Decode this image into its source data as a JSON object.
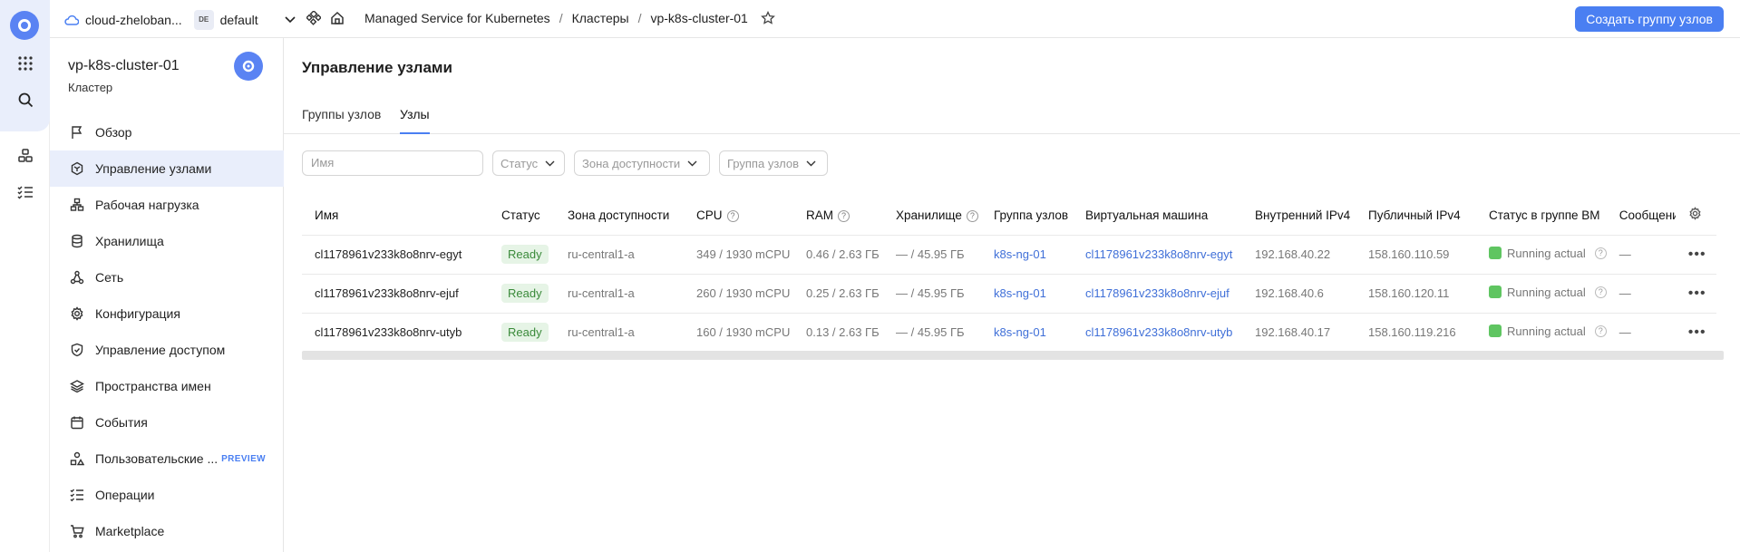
{
  "topbar": {
    "cloud_name": "cloud-zheloban...",
    "folder_badge": "DE",
    "folder_name": "default",
    "breadcrumbs": [
      "Managed Service for Kubernetes",
      "Кластеры",
      "vp-k8s-cluster-01"
    ],
    "create_button": "Создать группу узлов"
  },
  "sidebar": {
    "cluster_name": "vp-k8s-cluster-01",
    "cluster_type": "Кластер",
    "items": [
      {
        "label": "Обзор",
        "icon": "flag-icon"
      },
      {
        "label": "Управление узлами",
        "icon": "nodes-icon"
      },
      {
        "label": "Рабочая нагрузка",
        "icon": "workload-icon"
      },
      {
        "label": "Хранилища",
        "icon": "database-icon"
      },
      {
        "label": "Сеть",
        "icon": "network-icon"
      },
      {
        "label": "Конфигурация",
        "icon": "gear-icon"
      },
      {
        "label": "Управление доступом",
        "icon": "shield-icon"
      },
      {
        "label": "Пространства имен",
        "icon": "layers-icon"
      },
      {
        "label": "События",
        "icon": "calendar-icon"
      },
      {
        "label": "Пользовательские ...",
        "icon": "shapes-icon",
        "badge": "PREVIEW"
      },
      {
        "label": "Операции",
        "icon": "list-icon"
      },
      {
        "label": "Marketplace",
        "icon": "cart-icon"
      }
    ]
  },
  "main": {
    "title": "Управление узлами",
    "tabs": [
      "Группы узлов",
      "Узлы"
    ],
    "filters": {
      "name_placeholder": "Имя",
      "status": "Статус",
      "zone": "Зона доступности",
      "group": "Группа узлов"
    },
    "table": {
      "headers": [
        "Имя",
        "Статус",
        "Зона доступности",
        "CPU",
        "RAM",
        "Хранилище",
        "Группа узлов",
        "Виртуальная машина",
        "Внутренний IPv4",
        "Публичный IPv4",
        "Статус в группе ВМ",
        "Сообщени"
      ],
      "rows": [
        {
          "name": "cl1178961v233k8o8nrv-egyt",
          "status": "Ready",
          "zone": "ru-central1-a",
          "cpu": "349 / 1930 mCPU",
          "ram": "0.46 / 2.63 ГБ",
          "storage": "— / 45.95 ГБ",
          "group": "k8s-ng-01",
          "vm": "cl1178961v233k8o8nrv-egyt",
          "ip_int": "192.168.40.22",
          "ip_pub": "158.160.110.59",
          "vm_status": "Running actual",
          "message": "—"
        },
        {
          "name": "cl1178961v233k8o8nrv-ejuf",
          "status": "Ready",
          "zone": "ru-central1-a",
          "cpu": "260 / 1930 mCPU",
          "ram": "0.25 / 2.63 ГБ",
          "storage": "— / 45.95 ГБ",
          "group": "k8s-ng-01",
          "vm": "cl1178961v233k8o8nrv-ejuf",
          "ip_int": "192.168.40.6",
          "ip_pub": "158.160.120.11",
          "vm_status": "Running actual",
          "message": "—"
        },
        {
          "name": "cl1178961v233k8o8nrv-utyb",
          "status": "Ready",
          "zone": "ru-central1-a",
          "cpu": "160 / 1930 mCPU",
          "ram": "0.13 / 2.63 ГБ",
          "storage": "— / 45.95 ГБ",
          "group": "k8s-ng-01",
          "vm": "cl1178961v233k8o8nrv-utyb",
          "ip_int": "192.168.40.17",
          "ip_pub": "158.160.119.216",
          "vm_status": "Running actual",
          "message": "—"
        }
      ]
    }
  },
  "colors": {
    "accent": "#4a7ff2",
    "active_bg": "#e9eefb",
    "ready_bg": "#e6f4e6",
    "running": "#5fc561"
  }
}
